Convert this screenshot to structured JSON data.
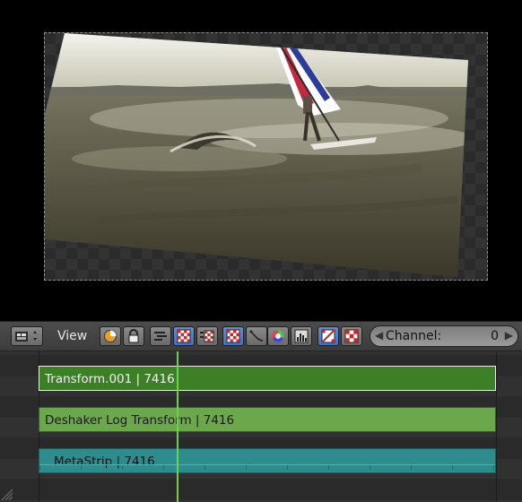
{
  "header": {
    "view_menu_label": "View",
    "channel": {
      "label": "Channel:",
      "value": "0"
    }
  },
  "icons": [
    "editor-type-icon",
    "preview-mode-icon",
    "lock-icon",
    "waveform-icon",
    "checker-overlay-icon",
    "checker-backdrop-icon",
    "checker-icon",
    "curve-icon",
    "color-wheel-icon",
    "histogram-icon",
    "safe-area-icon",
    "channel-checker-icon"
  ],
  "strips": [
    {
      "label": "Transform.001 | 7416",
      "color": "#3d7f26",
      "selected": true
    },
    {
      "label": "Deshaker Log Transform | 7416",
      "color": "#6aa84b",
      "selected": false
    },
    {
      "label": "MetaStrip | 7416",
      "color": "#2f8c8c",
      "selected": false
    }
  ],
  "colors": {
    "playhead": "#6cd24c",
    "active_button": "#4a7fd0"
  }
}
